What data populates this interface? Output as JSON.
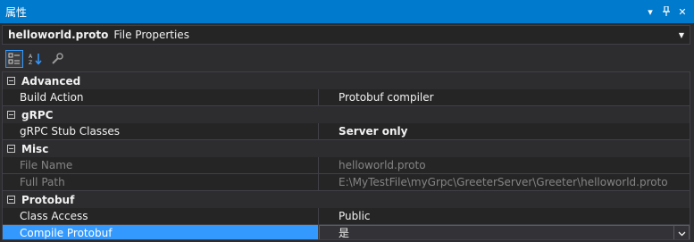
{
  "window": {
    "title": "属性",
    "pin_glyph": "▾",
    "pin2_glyph": "⊥",
    "close_glyph": "✕"
  },
  "object_bar": {
    "name": "helloworld.proto",
    "type": "File Properties",
    "dropdown_glyph": "▼"
  },
  "toolbar": {
    "categorized_icon": "categorized-icon",
    "alphabetical_icon": "alphabetical-icon",
    "property_pages_icon": "wrench-icon",
    "alpha_glyph": "↓"
  },
  "categories": [
    {
      "name": "Advanced",
      "rows": [
        {
          "name": "Build Action",
          "value": "Protobuf compiler"
        }
      ]
    },
    {
      "name": "gRPC",
      "rows": [
        {
          "name": "gRPC Stub Classes",
          "value": "Server only"
        }
      ]
    },
    {
      "name": "Misc",
      "rows": [
        {
          "name": "File Name",
          "value": "helloworld.proto"
        },
        {
          "name": "Full Path",
          "value": "E:\\MyTestFile\\myGrpc\\GreeterServer\\Greeter\\helloworld.proto"
        }
      ]
    },
    {
      "name": "Protobuf",
      "rows": [
        {
          "name": "Class Access",
          "value": "Public"
        },
        {
          "name": "Compile Protobuf",
          "value": "是"
        }
      ]
    }
  ],
  "colors": {
    "accent": "#007acc",
    "selection": "#3399ff",
    "background": "#252526"
  }
}
